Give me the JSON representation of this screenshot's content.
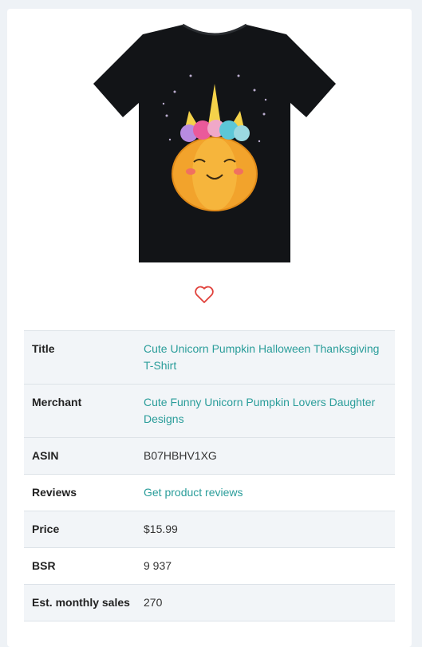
{
  "product": {
    "image_alt": "Black t-shirt with glitter unicorn pumpkin design",
    "wishlist_icon": "heart-outline-icon"
  },
  "details": [
    {
      "label": "Title",
      "value": "Cute Unicorn Pumpkin Halloween Thanksgiving T-Shirt",
      "link": true
    },
    {
      "label": "Merchant",
      "value": "Cute Funny Unicorn Pumpkin Lovers Daughter Designs",
      "link": true
    },
    {
      "label": "ASIN",
      "value": "B07HBHV1XG",
      "link": false
    },
    {
      "label": "Reviews",
      "value": "Get product reviews",
      "link": true
    },
    {
      "label": "Price",
      "value": "$15.99",
      "link": false
    },
    {
      "label": "BSR",
      "value": "9 937",
      "link": false
    },
    {
      "label": "Est. monthly sales",
      "value": "270",
      "link": false
    }
  ],
  "colors": {
    "link": "#2a9d9a",
    "heart": "#e0413b",
    "row_shade": "#f2f5f8"
  }
}
